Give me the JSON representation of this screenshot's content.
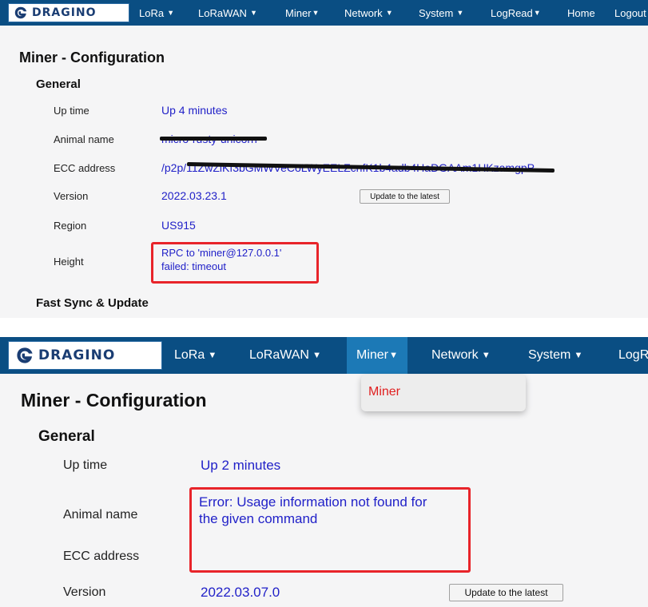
{
  "panels": [
    {
      "logo_text": "DRAGINO",
      "nav": [
        "LoRa",
        "LoRaWAN",
        "Miner",
        "Network",
        "System",
        "LogRead",
        "Home",
        "Logout"
      ],
      "title": "Miner - Configuration",
      "section": "General",
      "rows": [
        {
          "label": "Up time",
          "value": "Up 4 minutes"
        },
        {
          "label": "Animal name",
          "value": "micro-rusty-unicorn"
        },
        {
          "label": "ECC address",
          "value": "/p2p/11ZwZiKf3bGMWVeCoLWyEELZcnfK1b4adb4HaDGAAm1HKzamgpP"
        },
        {
          "label": "Version",
          "value": "2022.03.23.1"
        },
        {
          "label": "Region",
          "value": "US915"
        },
        {
          "label": "Height",
          "value_line1": "RPC to 'miner@127.0.0.1'",
          "value_line2": "failed: timeout"
        }
      ],
      "update_button": "Update to the latest",
      "next_section": "Fast Sync & Update"
    },
    {
      "logo_text": "DRAGINO",
      "nav": [
        "LoRa",
        "LoRaWAN",
        "Miner",
        "Network",
        "System",
        "LogR"
      ],
      "dropdown_item": "Miner",
      "title": "Miner - Configuration",
      "section": "General",
      "rows": [
        {
          "label": "Up time",
          "value": "Up 2 minutes"
        },
        {
          "label": "Animal name",
          "value_line1": "Error: Usage information not found for",
          "value_line2": "the given command"
        },
        {
          "label": "ECC address",
          "value": ""
        },
        {
          "label": "Version",
          "value": "2022.03.07.0"
        }
      ],
      "update_button": "Update to the latest"
    }
  ],
  "colors": {
    "navbar": "#0a4e83",
    "active_nav": "#1c79b6",
    "value_text": "#2121c8",
    "highlight_box": "#e8242a",
    "page_bg": "#f5f5f6"
  }
}
